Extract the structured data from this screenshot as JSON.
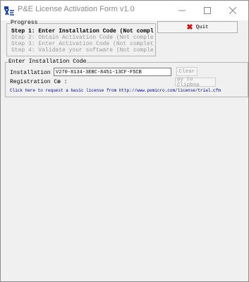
{
  "window": {
    "title": "P&E License Activation Form v1.0"
  },
  "progress": {
    "title": "Progress",
    "steps": [
      {
        "label": "Step 1: Enter Installation Code (Not compl",
        "active": true
      },
      {
        "label": "Step 2: Obtain Activation Code (Not comple",
        "active": false
      },
      {
        "label": "Step 3: Enter Activation Code (Not complet",
        "active": false
      },
      {
        "label": "Step 4: Validate your software (Not comple",
        "active": false
      }
    ]
  },
  "quit_button": {
    "label": "Quit"
  },
  "install": {
    "title": "Enter Installation Code",
    "installation_label": "Installation Co",
    "installation_value": "V270-8134-3EBC-8451-13CF-F5CB",
    "clear_label": "Clear",
    "registration_label": "Registration Co",
    "registration_suffix": "e :",
    "copy_label": "py to Clipboa",
    "link_text": "Click here to request a basic license from http://www.pemicro.com/license/trial.cfm"
  },
  "background": {
    "left_char": "k",
    "right_char": "R"
  }
}
